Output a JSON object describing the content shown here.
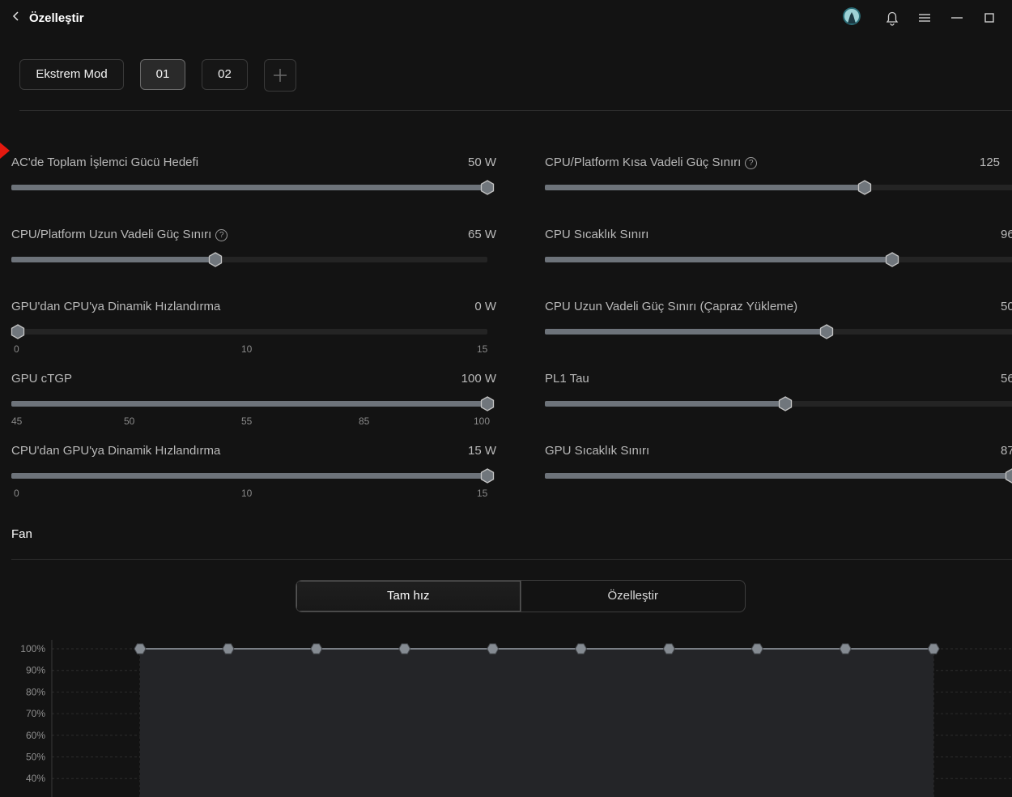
{
  "header": {
    "back_icon": "chevron-left-icon",
    "title": "Özelleştir"
  },
  "modes": {
    "items": [
      "Ekstrem Mod",
      "01",
      "02"
    ],
    "active_index": 1,
    "add_icon": "plus-icon"
  },
  "sliders_left": [
    {
      "label": "AC'de Toplam İşlemci Gücü Hedefi",
      "value": "50 W",
      "fraction": 1.0,
      "help": false,
      "ticks": []
    },
    {
      "label": "CPU/Platform Uzun Vadeli Güç Sınırı",
      "value": "65 W",
      "fraction": 0.42,
      "help": true,
      "ticks": []
    },
    {
      "label": "GPU'dan CPU'ya Dinamik Hızlandırma",
      "value": "0 W",
      "fraction": 0.0,
      "help": false,
      "ticks": [
        "0",
        "10",
        "15"
      ]
    },
    {
      "label": "GPU cTGP",
      "value": "100 W",
      "fraction": 1.0,
      "help": false,
      "ticks": [
        "45",
        "50",
        "55",
        "85",
        "100"
      ]
    },
    {
      "label": "CPU'dan GPU'ya Dinamik Hızlandırma",
      "value": "15 W",
      "fraction": 1.0,
      "help": false,
      "ticks": [
        "0",
        "10",
        "15"
      ]
    }
  ],
  "sliders_right": [
    {
      "label": "CPU/Platform Kısa Vadeli Güç Sınırı",
      "value": "125",
      "fraction": 0.67,
      "help": true
    },
    {
      "label": "CPU Sıcaklık Sınırı",
      "value": "96",
      "fraction": 0.73,
      "help": false
    },
    {
      "label": "CPU Uzun Vadeli Güç Sınırı (Çapraz Yükleme)",
      "value": "50",
      "fraction": 0.59,
      "help": false
    },
    {
      "label": "PL1 Tau",
      "value": "56",
      "fraction": 0.5,
      "help": false
    },
    {
      "label": "GPU Sıcaklık Sınırı",
      "value": "87",
      "fraction": 1.0,
      "help": false
    }
  ],
  "fan": {
    "title": "Fan",
    "modes": [
      "Tam hız",
      "Özelleştir"
    ],
    "active_index": 0,
    "y_ticks": [
      "100%",
      "90%",
      "80%",
      "70%",
      "60%",
      "50%",
      "40%"
    ],
    "points": [
      100,
      100,
      100,
      100,
      100,
      100,
      100,
      100,
      100,
      100
    ]
  },
  "colors": {
    "accent": "#e4190f",
    "track_fill": "#6d737a",
    "track_bg": "#242424",
    "background": "#131313"
  }
}
